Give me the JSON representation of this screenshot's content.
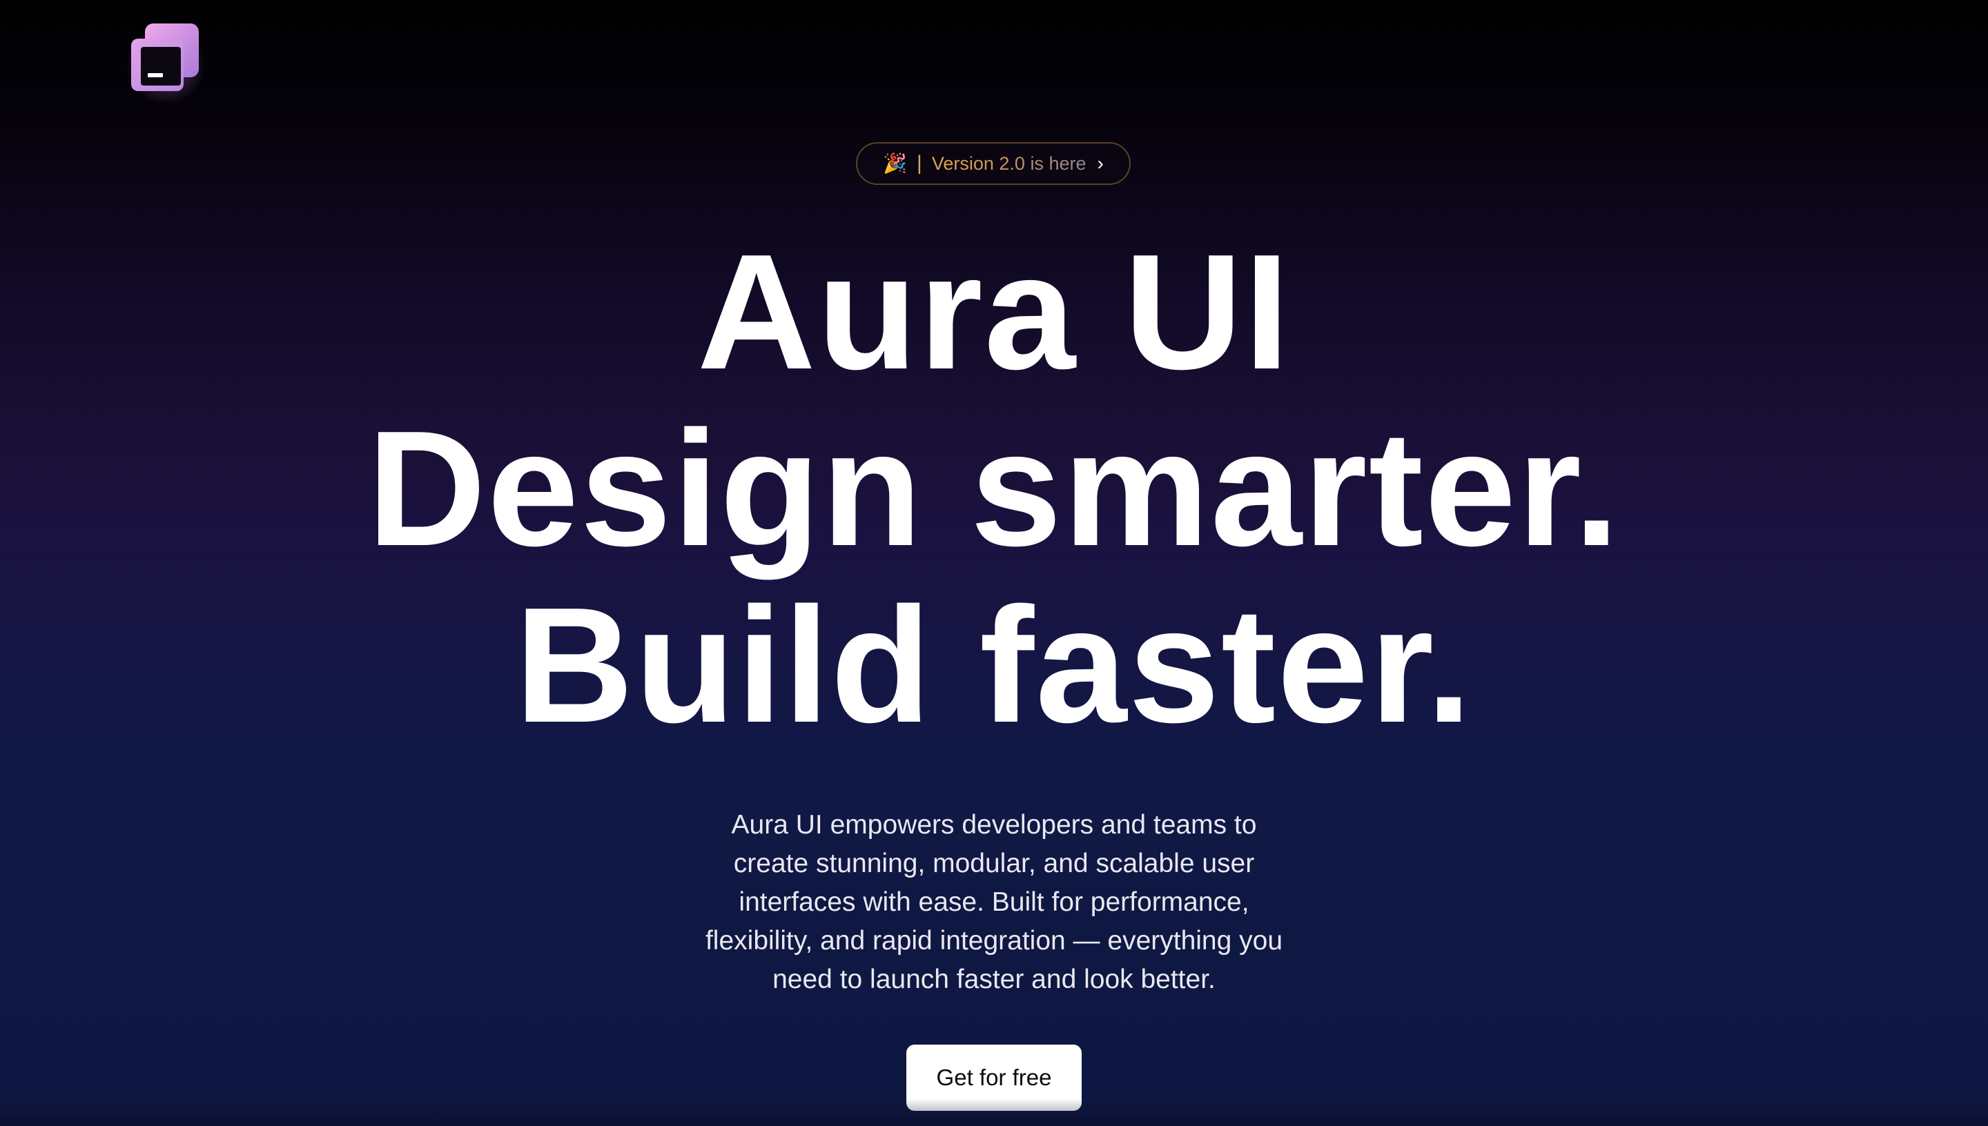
{
  "logo": {
    "icon": "terminal-window-icon",
    "colors": [
      "#f1a9ec",
      "#b98ae4",
      "#0c0812"
    ]
  },
  "badge": {
    "emoji": "🎉",
    "separator": "|",
    "text": "Version 2.0 is here",
    "chevron": "›",
    "border_color": "#5a4226",
    "text_color": "#d8a55d"
  },
  "hero": {
    "headline_lines": [
      "Aura UI",
      "Design smarter.",
      "Build faster."
    ],
    "description": "Aura UI empowers developers and teams to create stunning, modular, and scalable user interfaces with ease. Built for performance, flexibility, and rapid integration — everything you need to launch faster and look better.",
    "cta_label": "Get for free"
  },
  "theme": {
    "background_top": "#000000",
    "background_mid": "#1a0f35",
    "background_bottom": "#0e1741",
    "text": "#ffffff"
  }
}
